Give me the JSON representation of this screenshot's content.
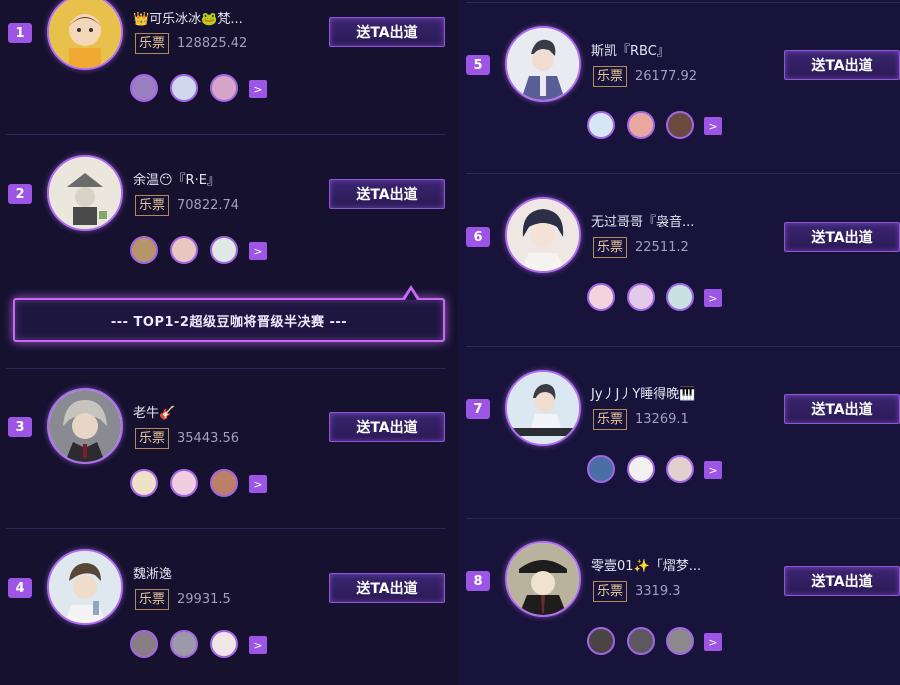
{
  "send_label": "送TA出道",
  "ticket_label": "乐票",
  "more_glyph": ">",
  "banner": "--- TOP1-2超级豆咖将晋级半决赛 ---",
  "entries": [
    {
      "rank": "1",
      "name": "👑可乐冰冰🐸梵...",
      "score": "128825.42",
      "avatar": "#e7c14b",
      "fans": [
        "#9a7fc0",
        "#cfd8ee",
        "#d6a4c6"
      ]
    },
    {
      "rank": "2",
      "name": "余温😶『R·E』",
      "score": "70822.74",
      "avatar": "#ebe7dd",
      "fans": [
        "#b8946a",
        "#e9c7c1",
        "#dfe8e2"
      ]
    },
    {
      "rank": "3",
      "name": "老牛🎸",
      "score": "35443.56",
      "avatar": "#8a8a93",
      "fans": [
        "#efe0c8",
        "#f1cde0",
        "#bb7f65"
      ]
    },
    {
      "rank": "4",
      "name": "魏淅逸",
      "score": "29931.5",
      "avatar": "#dfe7ef",
      "fans": [
        "#8a7e86",
        "#9c99a8",
        "#efe6ea"
      ]
    },
    {
      "rank": "5",
      "name": "斯凯『RBC』",
      "score": "26177.92",
      "avatar": "#e8ebf2",
      "fans": [
        "#d5e6f5",
        "#e8a8a0",
        "#6a4a3e"
      ]
    },
    {
      "rank": "6",
      "name": "无过哥哥『袅音...",
      "score": "22511.2",
      "avatar": "#efe7e3",
      "fans": [
        "#f3d4dc",
        "#e4c9ea",
        "#c9e2e1"
      ]
    },
    {
      "rank": "7",
      "name": "Jy丿J丿Y睡得晚🎹",
      "score": "13269.1",
      "avatar": "#dbe7f1",
      "fans": [
        "#4a6ea6",
        "#f1f1f1",
        "#e2cfd0"
      ]
    },
    {
      "rank": "8",
      "name": "零壹01✨「熠梦...",
      "score": "3319.3",
      "avatar": "#b9b39e",
      "fans": [
        "#4b4444",
        "#5d5760",
        "#8d8a8e"
      ]
    }
  ]
}
